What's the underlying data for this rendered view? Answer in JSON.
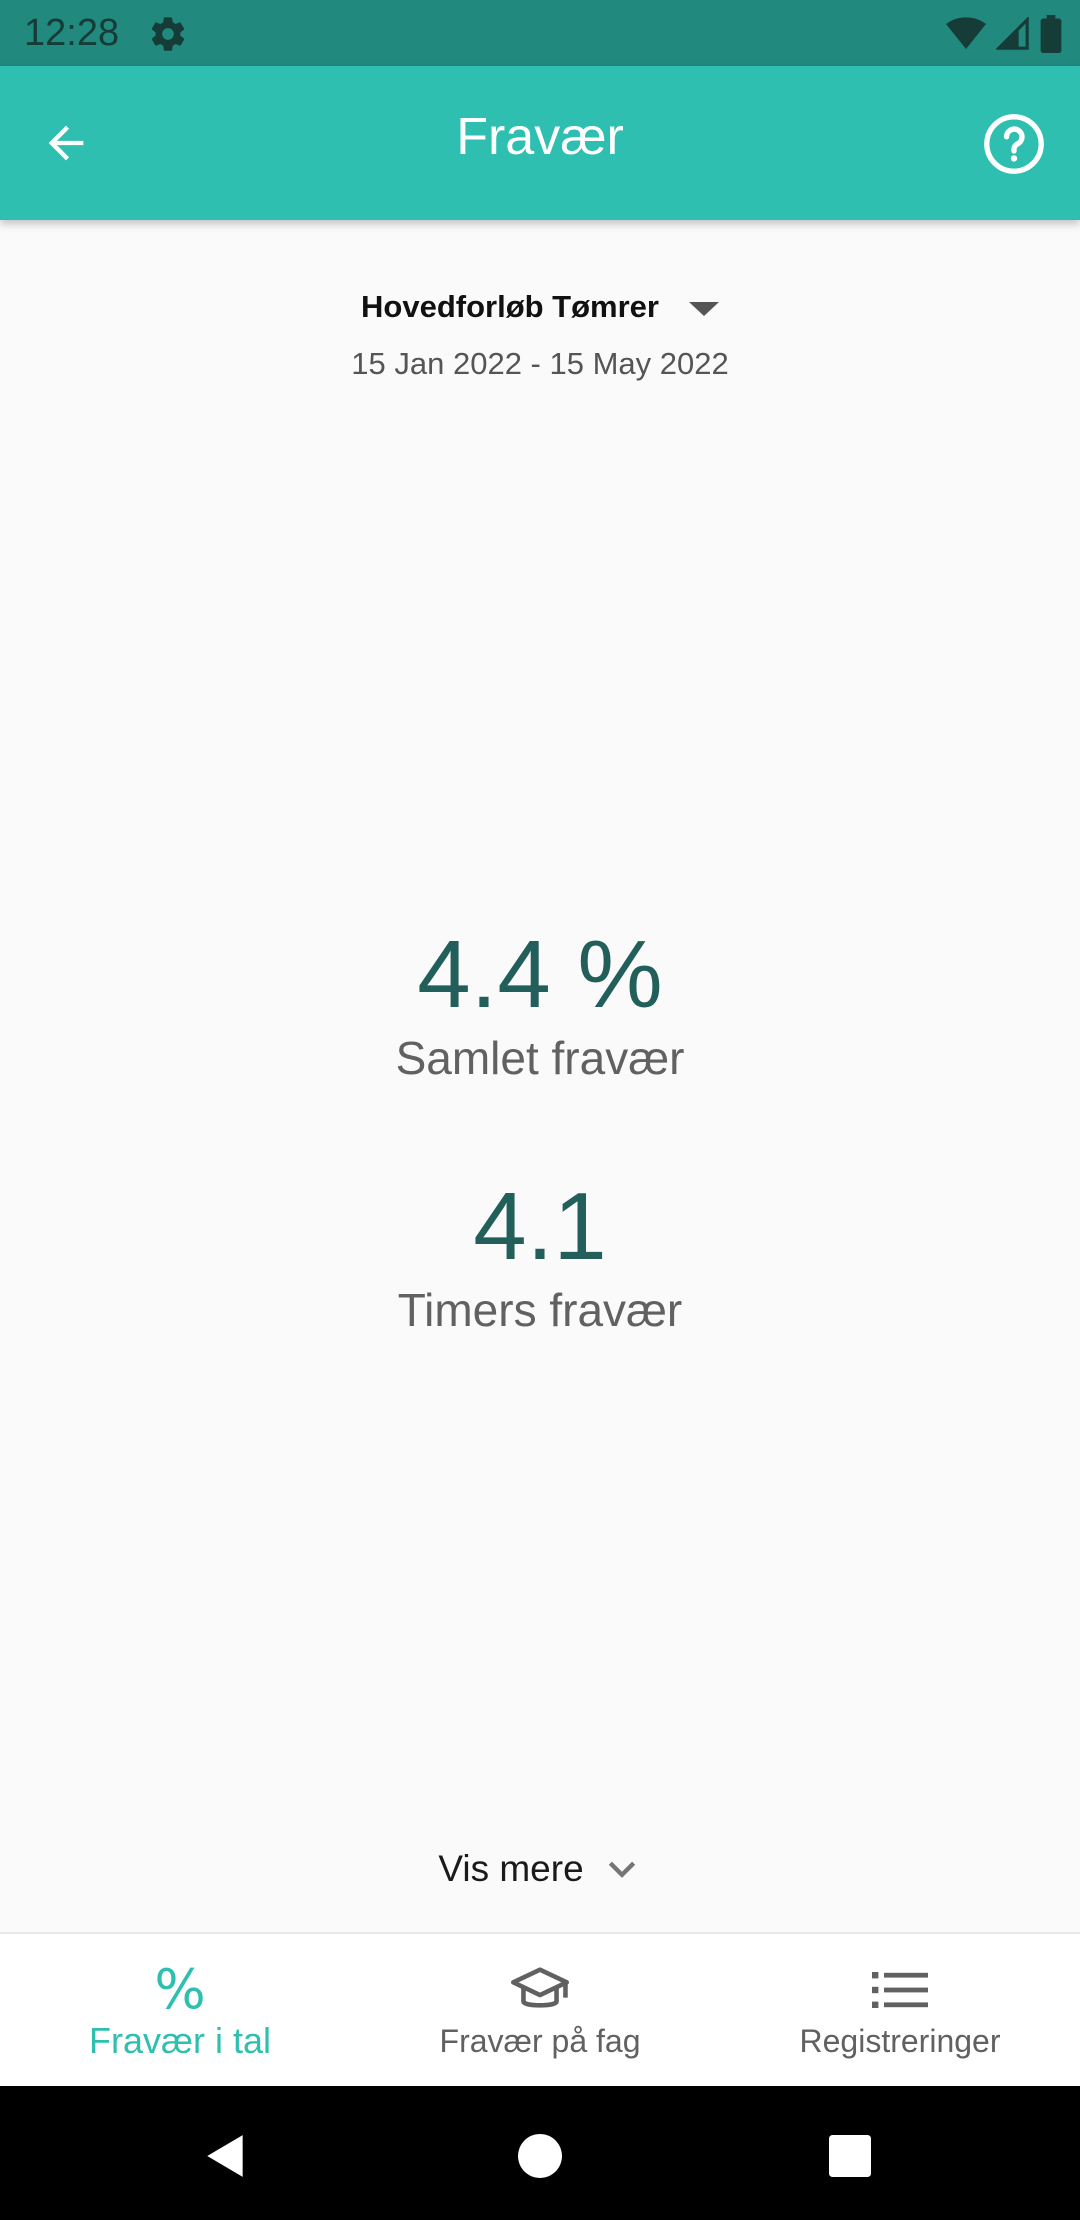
{
  "status_bar": {
    "time": "12:28",
    "icons": [
      "gear-icon",
      "wifi-icon",
      "signal-icon",
      "battery-icon"
    ]
  },
  "app_bar": {
    "title": "Fravær",
    "back_icon": "arrow-back-icon",
    "help_icon": "help-circle-icon"
  },
  "period": {
    "name": "Hovedforløb Tømrer",
    "dates": "15 Jan 2022 - 15 May 2022"
  },
  "stats": [
    {
      "value": "4.4 %",
      "label": "Samlet fravær"
    },
    {
      "value": "4.1",
      "label": "Timers fravær"
    }
  ],
  "vis_mere": {
    "label": "Vis mere"
  },
  "bottom_nav": {
    "items": [
      {
        "label": "Fravær i tal",
        "icon": "percent-icon",
        "glyph": "%",
        "active": true
      },
      {
        "label": "Fravær på fag",
        "icon": "graduation-cap-icon",
        "active": false
      },
      {
        "label": "Registreringer",
        "icon": "list-icon",
        "active": false
      }
    ]
  },
  "colors": {
    "status_bar": "#21897e",
    "app_bar": "#2ebfb0",
    "accent": "#2ebfb0",
    "stat_value": "#235f5a",
    "background": "#fafafa"
  }
}
